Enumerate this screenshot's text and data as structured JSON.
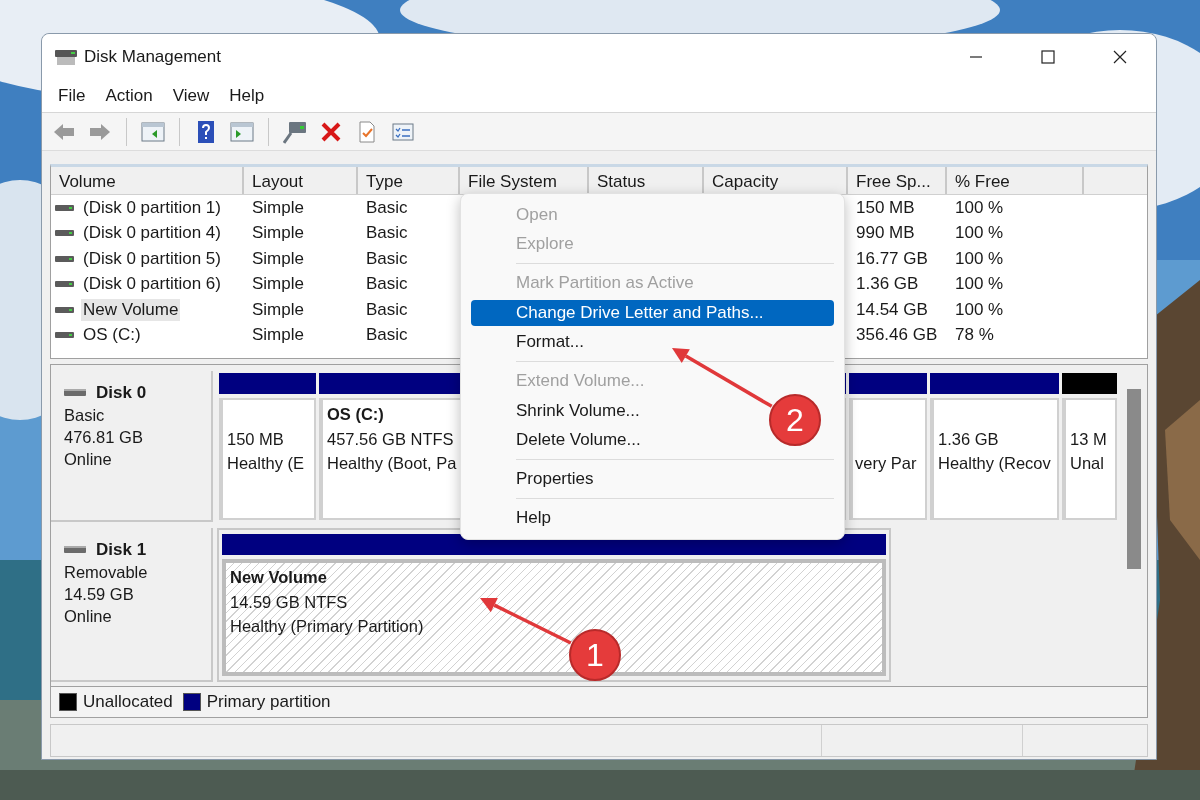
{
  "window": {
    "title": "Disk Management"
  },
  "menu_bar": [
    "File",
    "Action",
    "View",
    "Help"
  ],
  "toolbar": [
    {
      "kind": "back",
      "disabled": true
    },
    {
      "kind": "forward",
      "disabled": true
    },
    {
      "kind": "sep"
    },
    {
      "kind": "tree",
      "disabled": false
    },
    {
      "kind": "sep"
    },
    {
      "kind": "help",
      "disabled": false
    },
    {
      "kind": "pane",
      "disabled": false
    },
    {
      "kind": "sep"
    },
    {
      "kind": "connect",
      "disabled": false
    },
    {
      "kind": "delete",
      "disabled": false
    },
    {
      "kind": "check",
      "disabled": false
    },
    {
      "kind": "props",
      "disabled": false
    }
  ],
  "volume_table": {
    "columns": [
      "Volume",
      "Layout",
      "Type",
      "File System",
      "Status",
      "Capacity",
      "Free Sp...",
      "% Free"
    ],
    "rows": [
      {
        "volume": "(Disk 0 partition 1)",
        "layout": "Simple",
        "type": "Basic",
        "free_space": "150 MB",
        "percent_free": "100 %",
        "selected": false
      },
      {
        "volume": "(Disk 0 partition 4)",
        "layout": "Simple",
        "type": "Basic",
        "free_space": "990 MB",
        "percent_free": "100 %",
        "selected": false
      },
      {
        "volume": "(Disk 0 partition 5)",
        "layout": "Simple",
        "type": "Basic",
        "free_space": "16.77 GB",
        "percent_free": "100 %",
        "selected": false
      },
      {
        "volume": "(Disk 0 partition 6)",
        "layout": "Simple",
        "type": "Basic",
        "free_space": "1.36 GB",
        "percent_free": "100 %",
        "selected": false
      },
      {
        "volume": "New Volume",
        "layout": "Simple",
        "type": "Basic",
        "free_space": "14.54 GB",
        "percent_free": "100 %",
        "selected": true
      },
      {
        "volume": "OS (C:)",
        "layout": "Simple",
        "type": "Basic",
        "free_space": "356.46 GB",
        "percent_free": "78 %",
        "selected": false
      }
    ]
  },
  "disks": [
    {
      "name": "Disk 0",
      "type": "Basic",
      "size": "476.81 GB",
      "status": "Online",
      "partitions": [
        {
          "kind": "primary",
          "size": "150 MB",
          "status": "Healthy (E",
          "selected": false
        },
        {
          "kind": "primary",
          "title": "OS  (C:)",
          "size": "457.56 GB NTFS",
          "status": "Healthy (Boot, Pa",
          "selected": false
        },
        {
          "kind": "primary",
          "status": "very Par",
          "selected": false
        },
        {
          "kind": "primary",
          "size": "1.36 GB",
          "status": "Healthy (Recov",
          "selected": false
        },
        {
          "kind": "unallocated",
          "size": "13 M",
          "status": "Unal",
          "selected": false
        }
      ]
    },
    {
      "name": "Disk 1",
      "type": "Removable",
      "size": "14.59 GB",
      "status": "Online",
      "partitions": [
        {
          "kind": "primary",
          "title": "New Volume",
          "size": "14.59 GB NTFS",
          "status": "Healthy (Primary Partition)",
          "selected": true
        }
      ]
    }
  ],
  "legend": [
    {
      "label": "Unallocated",
      "color": "#000000"
    },
    {
      "label": "Primary partition",
      "color": "#000080"
    }
  ],
  "context_menu": [
    {
      "kind": "item",
      "label": "Open",
      "disabled": true,
      "selected": false
    },
    {
      "kind": "item",
      "label": "Explore",
      "disabled": true,
      "selected": false
    },
    {
      "kind": "separator"
    },
    {
      "kind": "item",
      "label": "Mark Partition as Active",
      "disabled": true,
      "selected": false
    },
    {
      "kind": "item",
      "label": "Change Drive Letter and Paths...",
      "disabled": false,
      "selected": true
    },
    {
      "kind": "item",
      "label": "Format...",
      "disabled": false,
      "selected": false
    },
    {
      "kind": "separator"
    },
    {
      "kind": "item",
      "label": "Extend Volume...",
      "disabled": true,
      "selected": false
    },
    {
      "kind": "item",
      "label": "Shrink Volume...",
      "disabled": false,
      "selected": false
    },
    {
      "kind": "item",
      "label": "Delete Volume...",
      "disabled": false,
      "selected": false
    },
    {
      "kind": "separator"
    },
    {
      "kind": "item",
      "label": "Properties",
      "disabled": false,
      "selected": false
    },
    {
      "kind": "separator"
    },
    {
      "kind": "item",
      "label": "Help",
      "disabled": false,
      "selected": false
    }
  ],
  "callouts": [
    {
      "label": "1"
    },
    {
      "label": "2"
    }
  ]
}
